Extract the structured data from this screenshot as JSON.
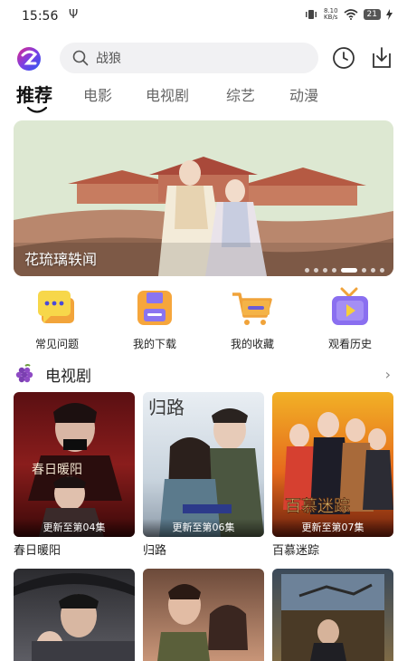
{
  "status": {
    "time": "15:56",
    "net_speed_value": "8.10",
    "net_speed_unit": "KB/s",
    "battery": "21"
  },
  "search": {
    "placeholder": "战狼"
  },
  "tabs": [
    {
      "label": "推荐",
      "active": true
    },
    {
      "label": "电影"
    },
    {
      "label": "电视剧"
    },
    {
      "label": "综艺"
    },
    {
      "label": "动漫"
    }
  ],
  "banner": {
    "title": "花琉璃轶闻",
    "slide_count": 8,
    "active_slide": 5
  },
  "quick_links": [
    {
      "label": "常见问题",
      "icon": "faq-chat-icon"
    },
    {
      "label": "我的下载",
      "icon": "download-save-icon"
    },
    {
      "label": "我的收藏",
      "icon": "favorite-cart-icon"
    },
    {
      "label": "观看历史",
      "icon": "history-play-icon"
    }
  ],
  "section": {
    "title": "电视剧",
    "icon": "grape-icon"
  },
  "cards": [
    {
      "name": "春日暖阳",
      "badge": "更新至第04集",
      "poster_text": "春日暖阳"
    },
    {
      "name": "归路",
      "badge": "更新至第06集",
      "poster_text": "归路"
    },
    {
      "name": "百慕迷踪",
      "badge": "更新至第07集",
      "poster_text": "百慕迷踪"
    }
  ],
  "colors": {
    "accent": "#3f51e0",
    "tab_active": "#111111",
    "tab_inactive": "#666666"
  }
}
